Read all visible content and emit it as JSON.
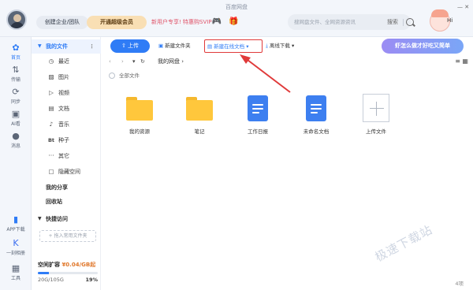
{
  "window": {
    "title": "百度网盘"
  },
  "header": {
    "enterprise_label": "创建企业/团队",
    "vip_label": "开通超级会员",
    "promo_text": "新用户专享! 特惠购SVIP",
    "search_placeholder": "搜网盘文件、全网资源资讯",
    "search_label": "搜索",
    "greeting": "Hi"
  },
  "rail": [
    {
      "label": "首页",
      "icon": "home-icon"
    },
    {
      "label": "传输",
      "icon": "transfer-icon"
    },
    {
      "label": "同步",
      "icon": "sync-icon"
    },
    {
      "label": "AI看",
      "icon": "ai-icon"
    },
    {
      "label": "消息",
      "icon": "message-icon"
    },
    {
      "label": "APP下载",
      "icon": "app-download-icon"
    },
    {
      "label": "一刻相册",
      "icon": "album-icon"
    },
    {
      "label": "工具",
      "icon": "tools-icon"
    }
  ],
  "sidebar": {
    "my_files": "我的文件",
    "items": [
      {
        "label": "最近",
        "icon": "clock-icon"
      },
      {
        "label": "图片",
        "icon": "image-icon"
      },
      {
        "label": "视频",
        "icon": "video-icon"
      },
      {
        "label": "文档",
        "icon": "document-icon"
      },
      {
        "label": "音乐",
        "icon": "music-icon"
      },
      {
        "label": "种子",
        "icon": "bt-icon",
        "glyph": "Bt"
      },
      {
        "label": "其它",
        "icon": "more-icon"
      },
      {
        "label": "隐藏空间",
        "icon": "lock-icon"
      }
    ],
    "share": "我的分享",
    "recycle": "回收站",
    "quick_access": "快捷访问",
    "quick_add": "+ 拖入常用文件夹",
    "storage": {
      "title": "空间扩容",
      "price": "¥0.04/GB起",
      "usage": "20G/105G",
      "percent": "19%",
      "percent_value": 19
    }
  },
  "toolbar": {
    "upload": "上传",
    "new_folder": "新建文件夹",
    "new_doc": "新建在线文档",
    "offline": "离线下载",
    "banner": "虾怎么做才好吃又简单"
  },
  "nav": {
    "path": "我的网盘",
    "all_files": "全部文件"
  },
  "files": [
    {
      "name": "我的资源",
      "type": "folder"
    },
    {
      "name": "笔记",
      "type": "folder"
    },
    {
      "name": "工作日报",
      "type": "doc"
    },
    {
      "name": "未命名文档",
      "type": "doc"
    },
    {
      "name": "上传文件",
      "type": "upload"
    }
  ],
  "status": {
    "count": "4项",
    "watermark": "极速下载站"
  },
  "colors": {
    "accent": "#2f7cf6",
    "highlight_border": "#e03a3a",
    "folder": "#ffc73c",
    "doc": "#3d7ff0"
  }
}
